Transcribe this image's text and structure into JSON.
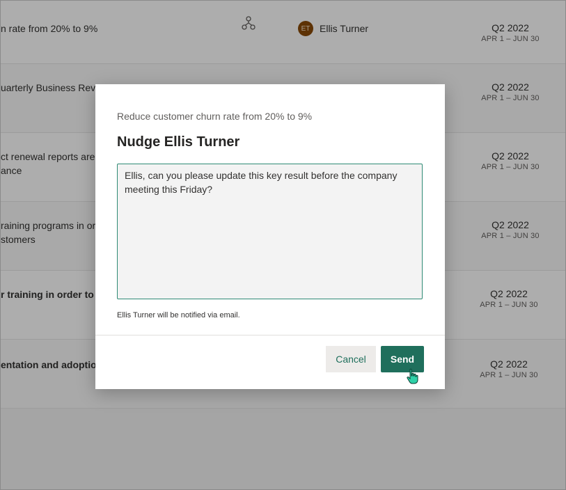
{
  "rows": [
    {
      "title": "n rate from 20% to 9%",
      "owner_initials": "ET",
      "owner_name": "Ellis Turner",
      "quarter": "Q2 2022",
      "range": "APR 1 – JUN 30"
    },
    {
      "title": "uarterly Business Review",
      "owner_initials": "",
      "owner_name": "",
      "quarter": "Q2 2022",
      "range": "APR 1 – JUN 30"
    },
    {
      "title_line1": "ct renewal reports are",
      "title_line2": "ance",
      "quarter": "Q2 2022",
      "range": "APR 1 – JUN 30"
    },
    {
      "title_line1": "raining programs in or",
      "title_line2": "stomers",
      "quarter": "Q2 2022",
      "range": "APR 1 – JUN 30"
    },
    {
      "title": "r training in order to s",
      "quarter": "Q2 2022",
      "range": "APR 1 – JUN 30"
    },
    {
      "title": "entation and adoption",
      "quarter": "Q2 2022",
      "range": "APR 1 – JUN 30"
    }
  ],
  "dialog": {
    "subtitle": "Reduce customer churn rate from 20% to 9%",
    "title": "Nudge Ellis Turner",
    "message": "Ellis, can you please update this key result before the company meeting this Friday?",
    "hint": "Ellis Turner will be notified via email.",
    "cancel_label": "Cancel",
    "send_label": "Send"
  },
  "colors": {
    "accent": "#1f6f5c",
    "avatar": "#8a4b08"
  }
}
